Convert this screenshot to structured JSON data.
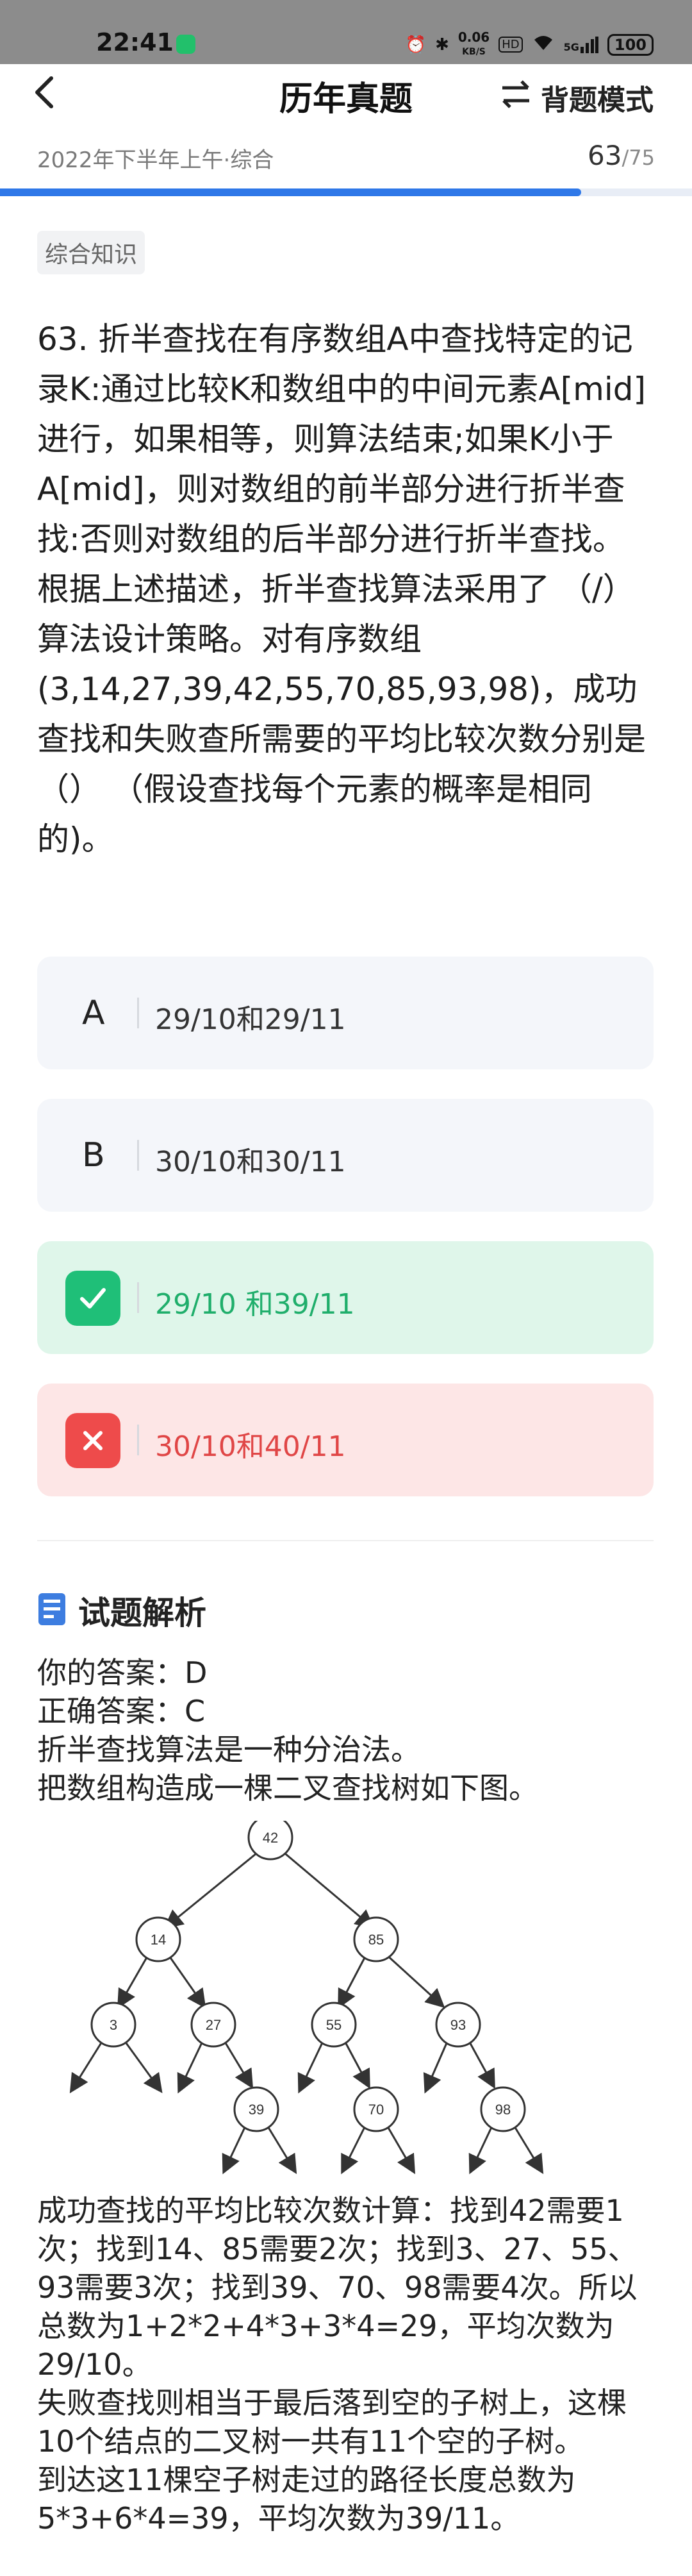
{
  "status": {
    "time": "22:41",
    "net_speed_value": "0.06",
    "net_speed_unit": "KB/S",
    "hd": "HD",
    "signal_label": "5G",
    "battery": "100"
  },
  "nav": {
    "back_icon": "chevron-left-icon",
    "title": "历年真题",
    "mode_label": "背题模式",
    "mode_icon": "swap-icon"
  },
  "exam": {
    "name": "2022年下半年上午·综合",
    "current": "63",
    "total": "/75",
    "progress_fraction": 0.84
  },
  "tag": "综合知识",
  "question": "63. 折半查找在有序数组A中查找特定的记录K:通过比较K和数组中的中间元素A[mid]进行，如果相等，则算法结束;如果K小于A[mid]，则对数组的前半部分进行折半查找:否则对数组的后半部分进行折半查找。根据上述描述，折半查找算法采用了 （/） 算法设计策略。对有序数组(3,14,27,39,42,55,70,85,93,98)，成功查找和失败查所需要的平均比较次数分别是 （） （假设查找每个元素的概率是相同的)。",
  "options": [
    {
      "letter": "A",
      "text": "29/10和29/11",
      "state": "normal"
    },
    {
      "letter": "B",
      "text": "30/10和30/11",
      "state": "normal"
    },
    {
      "letter": "C",
      "text": "29/10 和39/11",
      "state": "correct",
      "icon": "check-icon"
    },
    {
      "letter": "D",
      "text": "30/10和40/11",
      "state": "wrong",
      "icon": "cross-icon"
    }
  ],
  "analysis": {
    "title": "试题解析",
    "icon": "document-icon",
    "your_answer": "你的答案：D",
    "correct_answer": "正确答案：C",
    "line1": "折半查找算法是一种分治法。",
    "line2": "把数组构造成一棵二叉查找树如下图。",
    "tree_nodes": [
      "42",
      "14",
      "85",
      "3",
      "27",
      "55",
      "93",
      "39",
      "70",
      "98"
    ],
    "explain": [
      "成功查找的平均比较次数计算：找到42需要1次；找到14、85需要2次；找到3、27、55、93需要3次；找到39、70、98需要4次。所以总数为1+2*2+4*3+3*4=29，平均次数为29/10。",
      "失败查找则相当于最后落到空的子树上，这棵10个结点的二叉树一共有11个空的子树。",
      "到达这11棵空子树走过的路径长度总数为5*3+6*4=39，平均次数为39/11。"
    ]
  },
  "colors": {
    "accent": "#2f78e8",
    "correct": "#1fbf78",
    "wrong": "#ee4b4b"
  }
}
